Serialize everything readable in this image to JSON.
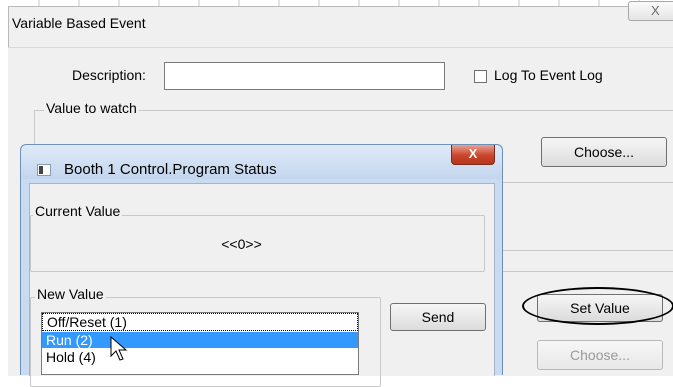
{
  "outer_dialog": {
    "title": "Variable Based Event",
    "close_label": "X",
    "description_label": "Description:",
    "description_value": "",
    "log_checked": false,
    "log_label": "Log To Event Log",
    "value_to_watch_label": "Value to watch",
    "choose_label": "Choose...",
    "set_value_label": "Set Value",
    "choose2_label": "Choose..."
  },
  "inner_dialog": {
    "title": "Booth 1 Control.Program Status",
    "close_label": "X",
    "current_value_label": "Current Value",
    "current_value": "<<0>>",
    "new_value_label": "New Value",
    "send_label": "Send",
    "options": [
      {
        "label": "Off/Reset (1)",
        "selected": false
      },
      {
        "label": "Run (2)",
        "selected": true
      },
      {
        "label": "Hold (4)",
        "selected": false
      }
    ]
  },
  "colors": {
    "selection": "#3399ff",
    "close_button": "#c9452b",
    "titlebar": "#c9dbf0"
  }
}
